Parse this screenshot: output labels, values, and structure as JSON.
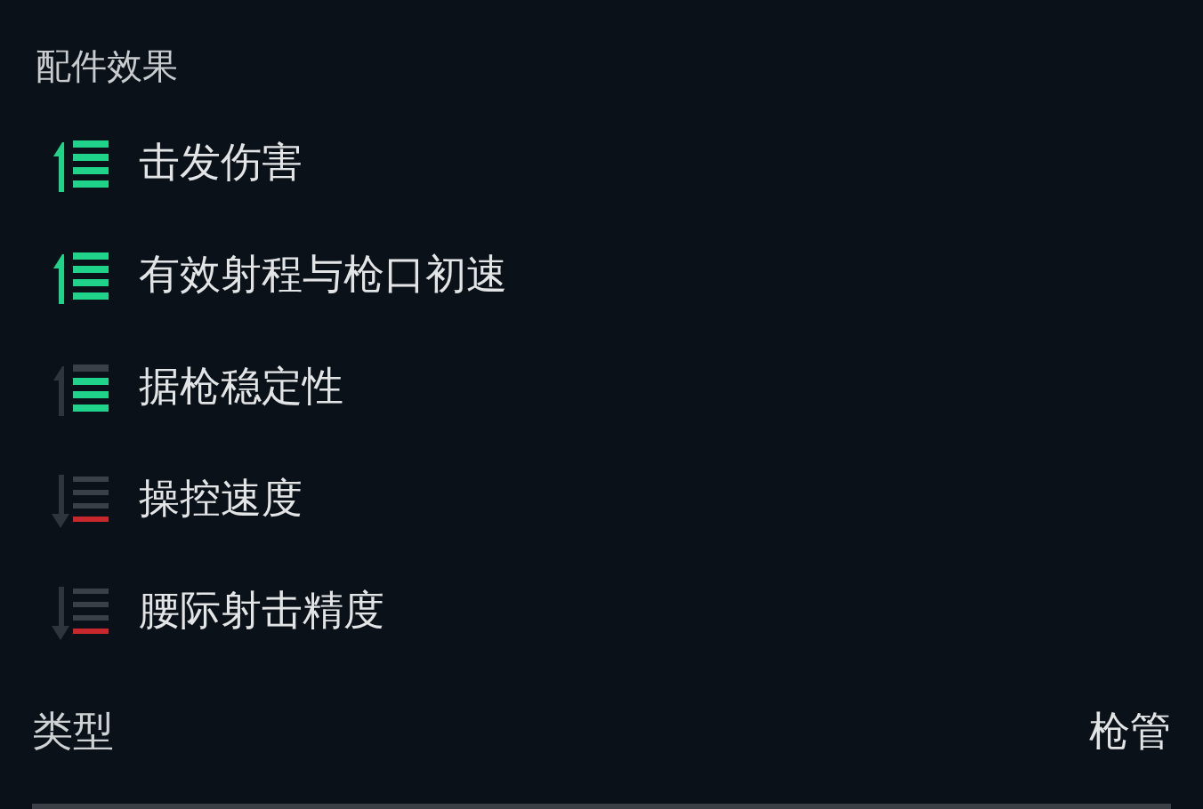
{
  "section_title": "配件效果",
  "effects": [
    {
      "label": "击发伤害",
      "kind": "high"
    },
    {
      "label": "有效射程与枪口初速",
      "kind": "high"
    },
    {
      "label": "据枪稳定性",
      "kind": "medium"
    },
    {
      "label": "操控速度",
      "kind": "low"
    },
    {
      "label": "腰际射击精度",
      "kind": "low"
    }
  ],
  "type_row": {
    "label": "类型",
    "value": "枪管"
  }
}
